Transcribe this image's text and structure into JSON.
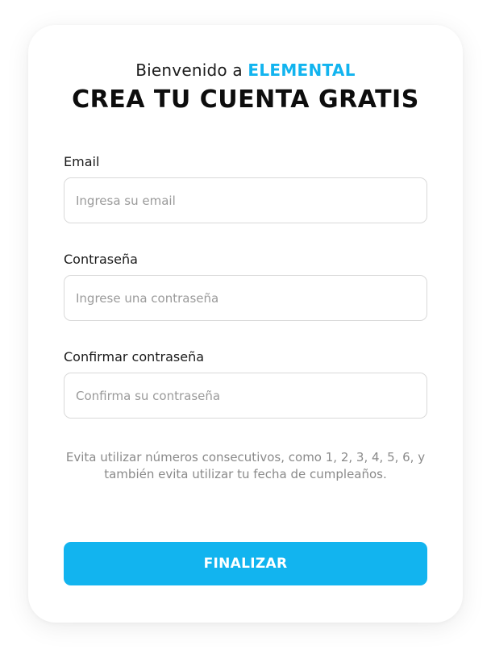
{
  "header": {
    "welcome_prefix": "Bienvenido a ",
    "brand": "ELEMENTAL",
    "title": "CREA TU CUENTA GRATIS"
  },
  "form": {
    "email": {
      "label": "Email",
      "placeholder": "Ingresa su email",
      "value": ""
    },
    "password": {
      "label": "Contraseña",
      "placeholder": "Ingrese una contraseña",
      "value": ""
    },
    "confirm_password": {
      "label": "Confirmar contraseña",
      "placeholder": "Confirma su contraseña",
      "value": ""
    },
    "hint": "Evita utilizar números consecutivos, como 1, 2, 3, 4, 5, 6, y también evita utilizar tu fecha de cumpleaños.",
    "submit_label": "FINALIZAR"
  },
  "colors": {
    "accent": "#12b4ef",
    "title": "#0d0d0d",
    "hint": "#8a8a8a",
    "input_border": "#d9d9d9"
  }
}
